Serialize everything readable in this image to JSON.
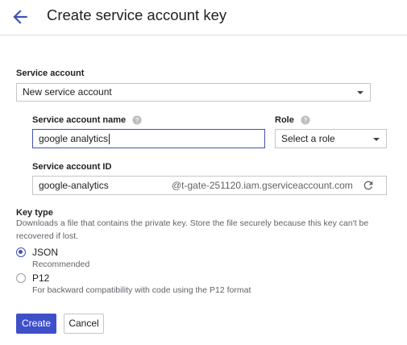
{
  "header": {
    "title": "Create service account key",
    "back_icon": "arrow-left-icon"
  },
  "service_account": {
    "label": "Service account",
    "selected": "New service account"
  },
  "service_account_name": {
    "label": "Service account name",
    "value": "google analytics"
  },
  "role": {
    "label": "Role",
    "selected": "Select a role"
  },
  "service_account_id": {
    "label": "Service account ID",
    "value": "google-analytics",
    "suffix": "@t-gate-251120.iam.gserviceaccount.com",
    "refresh_icon": "refresh-icon"
  },
  "key_type": {
    "label": "Key type",
    "description": "Downloads a file that contains the private key. Store the file securely because this key can't be recovered if lost.",
    "options": [
      {
        "label": "JSON",
        "sub": "Recommended",
        "selected": true
      },
      {
        "label": "P12",
        "sub": "For backward compatibility with code using the P12 format",
        "selected": false
      }
    ]
  },
  "actions": {
    "create_label": "Create",
    "cancel_label": "Cancel"
  },
  "colors": {
    "accent": "#3f51b5",
    "primary_button": "#3f4fc8"
  }
}
